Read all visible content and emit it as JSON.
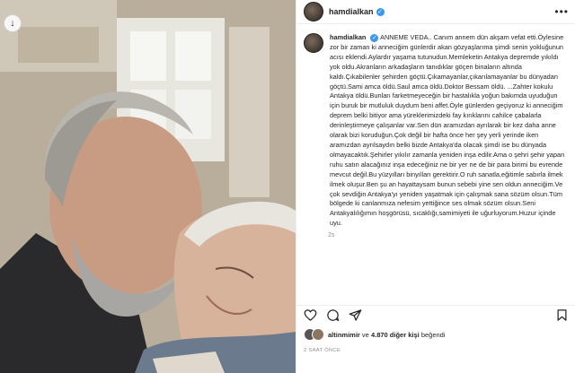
{
  "header": {
    "username": "hamdialkan",
    "verified_glyph": "✓",
    "more_icon": "more-horizontal-icon",
    "more_label": "•••"
  },
  "photo": {
    "download_icon": "download-icon",
    "download_glyph": "↓"
  },
  "caption": {
    "username": "hamdialkan",
    "text": "ANNEME VEDA.. Canım annem dün akşam vefat etti.Öylesine zor bir zaman ki anneciğim günlerdir akan gözyaşlarıma şimdi senin yokluğunun acısı eklendi.Aylardır yaşama tutunudun.Memleketin Antakya depremde yıkıldı yok oldu.Akranların arkadaşların tanıdıklar göçen binaların altında kaldı.Çıkabilenler şehirden göçtü.Çıkamayanlar,çıkarılamayanlar bu dünyadan göçtü.Sami amca öldü.Saul amca öldü.Doktor Bessam öldü. ...Zahter kokulu Antakya öldü.Bunları farketmeyeceğin bir hastalıkla yoğun bakımda uyuduğun için buruk bir mutluluk duydum beni affet.Öyle günlerden geçiyoruz ki anneciğim deprem belki bitiyor ama yüreklerimizdeki fay kırıklarını cahilce çabalarla derinleştirmeye çalışanlar var.Sen dün aramızdan ayrılarak bir kez daha anne olarak bizi koruduğun.Çok değil bir hafta önce her şey yerli yerinde iken aramızdan ayrılsaydın belki bizde Antakya'da olacak şimdi ise bu dünyada olmayacaktık.Şehirler yıkılır zamanla yeniden inşa edilir.Ama o şehri şehir yapan ruhu satın alacağınız inşa edeceğiniz ne bir yer ne de bir para birimi bu evrende mevcut değil.Bu yüzyılları binyılları gerektirir.O ruh sanatla,eğitimle sabırla ilmek ilmek oluşur.Ben şu an hayattaysam bunun sebebi yine sen oldun anneciğim.Ve çok sevdiğin Antakya'yı yeniden yaşatmak için çalışmak sana sözüm olsun.Tüm bölgede ki canlanmıza nefesim yettiğince ses olmak sözüm olsun.Seni Antakyalılığımın hoşgörüsü, sıcaklığı,samimiyeti ile uğurluyorum.Huzur içinde uyu.",
    "time": "2s"
  },
  "actions": {
    "like_icon": "heart-icon",
    "comment_icon": "comment-icon",
    "share_icon": "share-icon",
    "save_icon": "bookmark-icon"
  },
  "likes": {
    "prefix_user": "altinmimir",
    "middle": " ve ",
    "count_text": "4.870 diğer kişi",
    "suffix": " beğendi"
  },
  "posted": "2 SAAT ÖNCE"
}
